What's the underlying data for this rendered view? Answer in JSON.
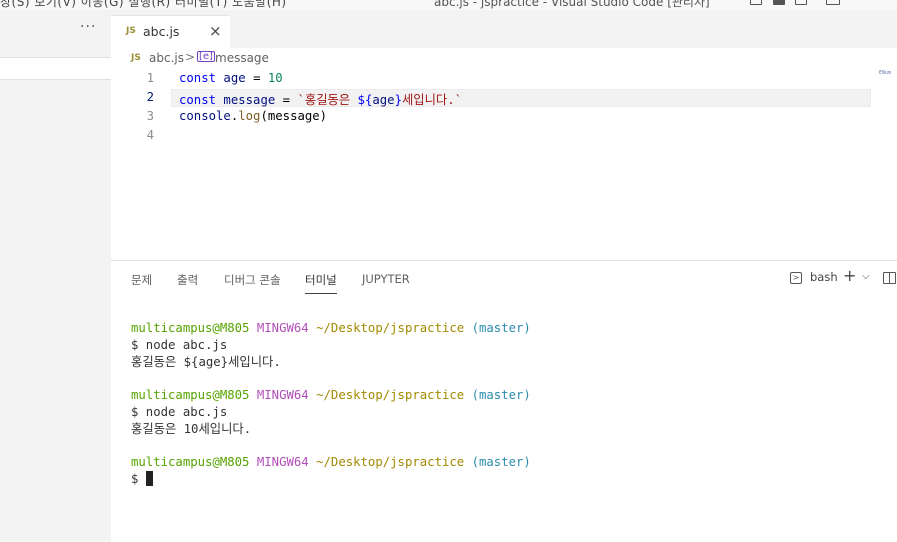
{
  "window": {
    "menu_text": "창(S)   보기(V)   이동(G)   실행(R)   터미널(T)   도움말(H)",
    "title": "abc.js - jspractice - Visual Studio Code [관리자]"
  },
  "sidebar": {
    "more_label": "···"
  },
  "tab": {
    "icon": "JS",
    "name": "abc.js",
    "close": "×"
  },
  "breadcrumb": {
    "icon": "JS",
    "file": "abc.js",
    "separator": ">",
    "symbol_icon": "[e]",
    "symbol": "message"
  },
  "editor": {
    "lines": [
      {
        "num": "1",
        "tokens": [
          "const",
          " age ",
          "=",
          " 10"
        ]
      },
      {
        "num": "2",
        "tokens": [
          "const",
          " message ",
          "=",
          " `홍길동은 ",
          "${",
          "age",
          "}",
          "세입니다.`"
        ]
      },
      {
        "num": "3",
        "tokens": [
          "console",
          ".",
          "log",
          "(message)"
        ]
      },
      {
        "num": "4",
        "tokens": []
      }
    ],
    "minimap_label": "ENum"
  },
  "panel": {
    "tabs": [
      "문제",
      "출력",
      "디버그 콘솔",
      "터미널",
      "JUPYTER"
    ],
    "active_tab": "터미널",
    "shell": "bash",
    "add": "+",
    "dropdown": "⌵"
  },
  "terminal": {
    "prompt_user": "multicampus@M805",
    "prompt_sys": "MINGW64",
    "prompt_path": "~/Desktop/jspractice",
    "prompt_branch": "(master)",
    "cmd1": "$ node abc.js",
    "out1": "홍길동은 ${age}세입니다.",
    "cmd2": "$ node abc.js",
    "out2": "홍길동은 10세입니다.",
    "prompt_sign": "$"
  },
  "colors": {
    "keyword": "#0000ff",
    "variable": "#001080",
    "number": "#098658",
    "string": "#a31515",
    "prompt_green": "#56a300",
    "prompt_magenta": "#b14fb9",
    "prompt_yellow": "#a18a00",
    "prompt_cyan": "#2d8cae"
  }
}
